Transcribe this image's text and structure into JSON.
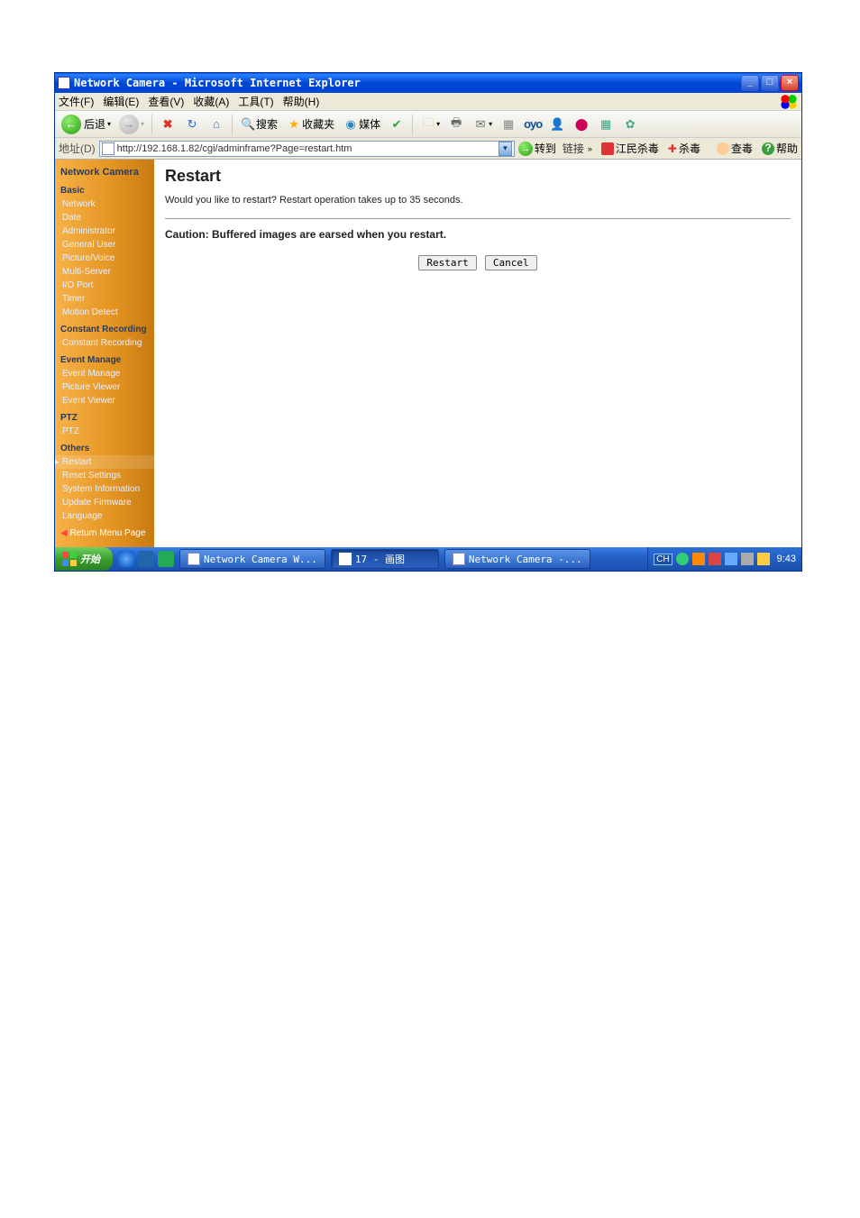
{
  "window": {
    "title": "Network Camera - Microsoft Internet Explorer"
  },
  "menubar": {
    "file": "文件(F)",
    "edit": "编辑(E)",
    "view": "查看(V)",
    "favorites": "收藏(A)",
    "tools": "工具(T)",
    "help": "帮助(H)"
  },
  "toolbar": {
    "back": "后退",
    "search": "搜索",
    "favorites": "收藏夹",
    "media": "媒体",
    "oyo": "oyo"
  },
  "addressbar": {
    "label": "地址(D)",
    "url": "http://192.168.1.82/cgi/adminframe?Page=restart.htm",
    "go": "转到",
    "links": "链接",
    "ext1": "江民杀毒",
    "ext2": "杀毒",
    "ext3": "查毒",
    "ext4": "帮助"
  },
  "sidebar": {
    "main_title": "Network Camera",
    "sections": {
      "basic": {
        "title": "Basic",
        "items": [
          "Network",
          "Date",
          "Administrator",
          "General User",
          "Picture/Voice",
          "Multi-Server",
          "I/O Port",
          "Timer",
          "Motion Detect"
        ]
      },
      "cr": {
        "title": "Constant Recording",
        "items": [
          "Constant Recording"
        ]
      },
      "em": {
        "title": "Event Manage",
        "items": [
          "Event Manage",
          "Picture Viewer",
          "Event Viewer"
        ]
      },
      "ptz": {
        "title": "PTZ",
        "items": [
          "PTZ"
        ]
      },
      "others": {
        "title": "Others",
        "items": [
          "Restart",
          "Reset Settings",
          "System Information",
          "Update Firmware",
          "Language"
        ]
      }
    },
    "return": "Return Menu Page"
  },
  "main": {
    "heading": "Restart",
    "prompt": "Would you like to restart? Restart operation takes up to 35 seconds.",
    "caution": "Caution: Buffered images are earsed when you restart.",
    "restart_btn": "Restart",
    "cancel_btn": "Cancel"
  },
  "taskbar": {
    "start": "开始",
    "task1": "Network Camera W...",
    "task2": "17 - 画图",
    "task3": "Network Camera -...",
    "lang": "CH",
    "clock": "9:43"
  }
}
